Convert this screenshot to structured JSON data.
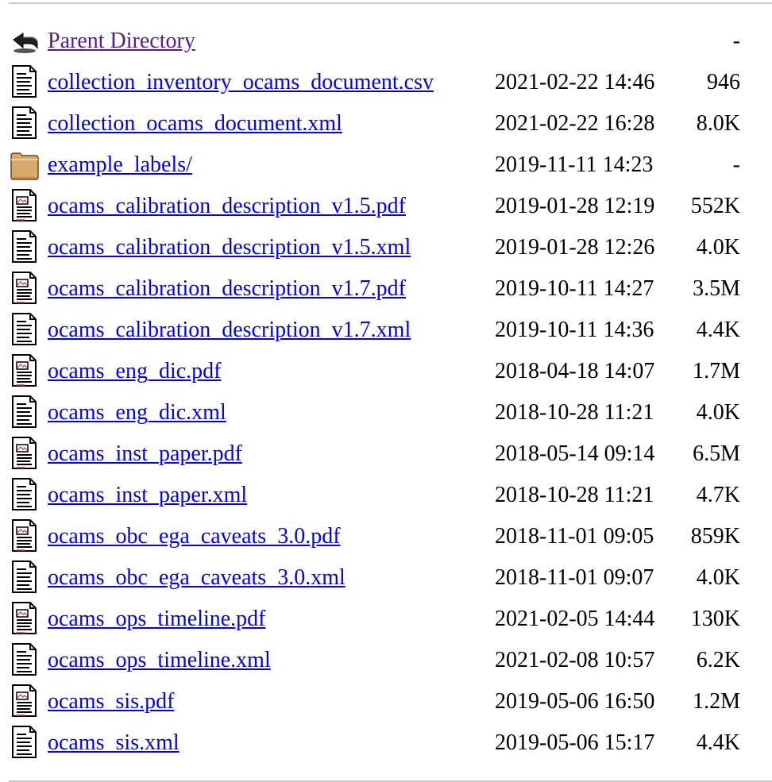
{
  "listing": {
    "parent": {
      "label": "Parent Directory",
      "size": "-",
      "icon": "back-arrow-icon"
    },
    "entries": [
      {
        "name": "collection_inventory_ocams_document.csv",
        "modified": "2021-02-22 14:46",
        "size": "946",
        "icon": "text-file-icon"
      },
      {
        "name": "collection_ocams_document.xml",
        "modified": "2021-02-22 16:28",
        "size": "8.0K",
        "icon": "text-file-icon"
      },
      {
        "name": "example_labels/",
        "modified": "2019-11-11 14:23",
        "size": "-",
        "icon": "folder-icon"
      },
      {
        "name": "ocams_calibration_description_v1.5.pdf",
        "modified": "2019-01-28 12:19",
        "size": "552K",
        "icon": "layout-file-icon"
      },
      {
        "name": "ocams_calibration_description_v1.5.xml",
        "modified": "2019-01-28 12:26",
        "size": "4.0K",
        "icon": "text-file-icon"
      },
      {
        "name": "ocams_calibration_description_v1.7.pdf",
        "modified": "2019-10-11 14:27",
        "size": "3.5M",
        "icon": "layout-file-icon"
      },
      {
        "name": "ocams_calibration_description_v1.7.xml",
        "modified": "2019-10-11 14:36",
        "size": "4.4K",
        "icon": "text-file-icon"
      },
      {
        "name": "ocams_eng_dic.pdf",
        "modified": "2018-04-18 14:07",
        "size": "1.7M",
        "icon": "layout-file-icon"
      },
      {
        "name": "ocams_eng_dic.xml",
        "modified": "2018-10-28 11:21",
        "size": "4.0K",
        "icon": "text-file-icon"
      },
      {
        "name": "ocams_inst_paper.pdf",
        "modified": "2018-05-14 09:14",
        "size": "6.5M",
        "icon": "layout-file-icon"
      },
      {
        "name": "ocams_inst_paper.xml",
        "modified": "2018-10-28 11:21",
        "size": "4.7K",
        "icon": "text-file-icon"
      },
      {
        "name": "ocams_obc_ega_caveats_3.0.pdf",
        "modified": "2018-11-01 09:05",
        "size": "859K",
        "icon": "layout-file-icon"
      },
      {
        "name": "ocams_obc_ega_caveats_3.0.xml",
        "modified": "2018-11-01 09:07",
        "size": "4.0K",
        "icon": "text-file-icon"
      },
      {
        "name": "ocams_ops_timeline.pdf",
        "modified": "2021-02-05 14:44",
        "size": "130K",
        "icon": "layout-file-icon"
      },
      {
        "name": "ocams_ops_timeline.xml",
        "modified": "2021-02-08 10:57",
        "size": "6.2K",
        "icon": "text-file-icon"
      },
      {
        "name": "ocams_sis.pdf",
        "modified": "2019-05-06 16:50",
        "size": "1.2M",
        "icon": "layout-file-icon"
      },
      {
        "name": "ocams_sis.xml",
        "modified": "2019-05-06 15:17",
        "size": "4.4K",
        "icon": "text-file-icon"
      }
    ]
  },
  "colors": {
    "link": "#0000ee",
    "visited_link": "#551a8b",
    "rule": "#c8c8c8"
  }
}
